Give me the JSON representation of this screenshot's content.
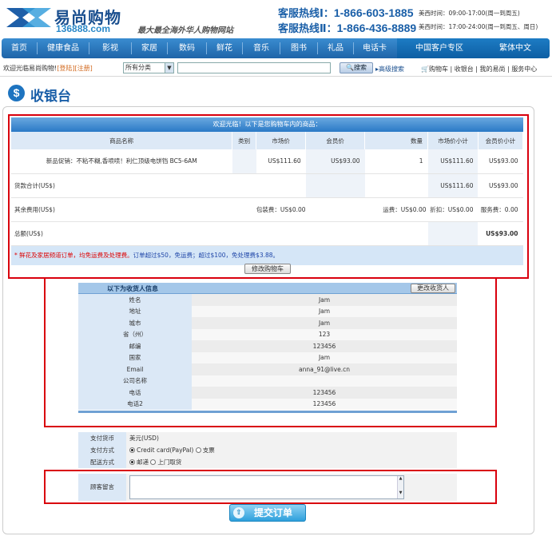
{
  "header": {
    "logo_name": "易尚购物",
    "logo_url": "136888.com",
    "slogan": "最大最全海外华人购物网站",
    "hotline1_label": "客服热线Ⅰ：",
    "hotline1_number": "1-866-603-1885",
    "hotline2_label": "客服热线Ⅱ：",
    "hotline2_number": "1-866-436-8889",
    "time1": "美西时间：09:00-17:00(周一到周五)",
    "time2": "美西时间：17:00-24:00(周一到周五、周日)"
  },
  "nav": {
    "items": [
      "首页",
      "健康食品",
      "影视",
      "家居",
      "数码",
      "鲜花",
      "音乐",
      "图书",
      "礼品",
      "电话卡"
    ],
    "special": [
      "中国客户专区",
      "繁体中文"
    ]
  },
  "searchbar": {
    "welcome": "欢迎光临易尚购物!",
    "login": "[登陆]",
    "register": "[注册]",
    "category": "所有分类",
    "search_label": "搜索",
    "advanced": "高级搜索",
    "cart": "购物车",
    "checkout": "收银台",
    "my_account": "我的易尚",
    "service": "服务中心"
  },
  "page": {
    "title": "收银台"
  },
  "cart": {
    "header": "欢迎光临！以下是您购物车内的商品：",
    "columns": [
      "商品名称",
      "类别",
      "市场价",
      "会员价",
      "数量",
      "市场价小计",
      "会员价小计"
    ],
    "item": {
      "name": "新品促销：不粘不糊,香喷喷！利仁顶级电饼铛 BC5-6AM",
      "category": "",
      "market_price": "US$111.60",
      "member_price": "US$93.00",
      "qty": "1",
      "market_subtotal": "US$111.60",
      "member_subtotal": "US$93.00"
    },
    "goods_total_label": "货款合计(US$)",
    "goods_total_market": "US$111.60",
    "goods_total_member": "US$93.00",
    "other_label": "其余费用(US$)",
    "packing": "包装费：US$0.00",
    "shipping": "运费：US$0.00",
    "discount": "折扣：US$0.00",
    "service_fee": "服务费：0.00",
    "grand_label": "总额(US$)",
    "grand_total": "US$93.00",
    "notice_red": "* 鲜花及家居频道订单，均免运费及处理费。",
    "notice_blue": "订单超过$50，免运费；超过$100，免处理费$3.88。",
    "modify_label": "修改购物车"
  },
  "consignee": {
    "title": "以下为收货人信息",
    "change_label": "更改收货人",
    "rows": [
      {
        "k": "姓名",
        "v": "Jam"
      },
      {
        "k": "地址",
        "v": "Jam"
      },
      {
        "k": "城市",
        "v": "Jam"
      },
      {
        "k": "省（州）",
        "v": "123"
      },
      {
        "k": "邮编",
        "v": "123456"
      },
      {
        "k": "国家",
        "v": "Jam"
      },
      {
        "k": "Email",
        "v": "anna_91@live.cn"
      },
      {
        "k": "公司名称",
        "v": ""
      },
      {
        "k": "电话",
        "v": "123456"
      },
      {
        "k": "电话2",
        "v": "123456"
      }
    ]
  },
  "payment": {
    "currency_label": "支付货币",
    "currency_value": "美元(USD)",
    "method_label": "支付方式",
    "method_opt1": "Credit card(PayPal)",
    "method_opt2": "支票",
    "delivery_label": "配送方式",
    "delivery_opt1": "邮递",
    "delivery_opt2": "上门取货",
    "message_label": "顾客留言",
    "message_value": "",
    "submit_label": "提交订单"
  }
}
